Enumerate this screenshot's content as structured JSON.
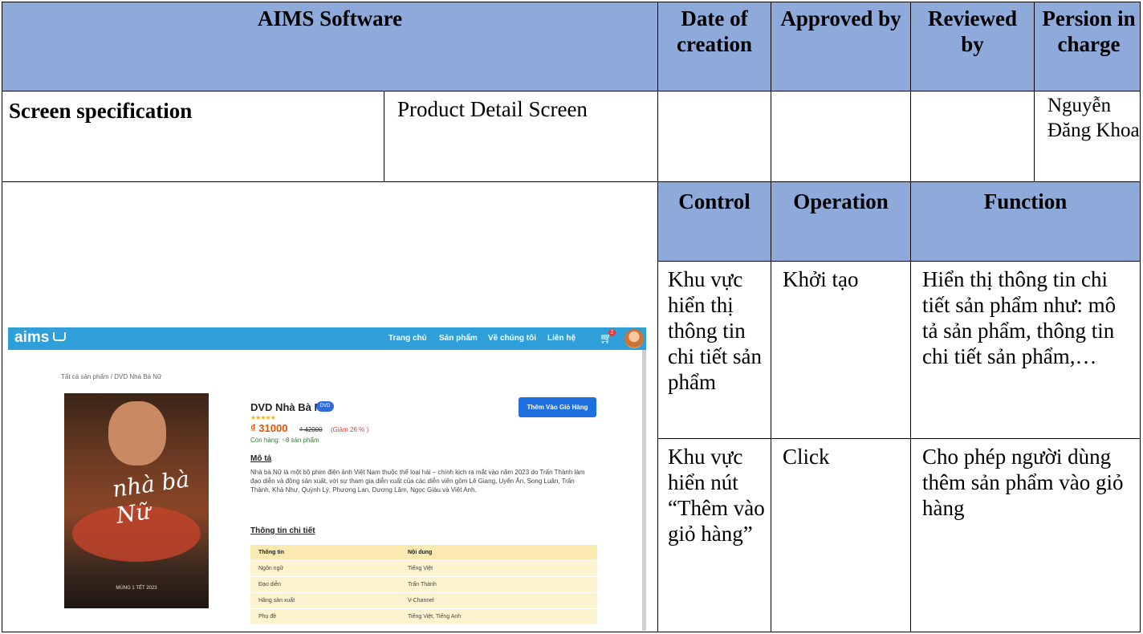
{
  "header": {
    "app": "AIMS Software",
    "date_of_creation": "Date of creation",
    "approved_by": "Approved by",
    "reviewed_by": "Reviewed by",
    "person_in_charge": "Persion in charge"
  },
  "spec": {
    "label": "Screen specification",
    "screen_name": "Product Detail Screen",
    "person": "Nguyễn Đăng Khoa"
  },
  "columns": {
    "control": "Control",
    "operation": "Operation",
    "function": "Function"
  },
  "rows": [
    {
      "control": "Khu vực hiển thị thông tin chi tiết sản phẩm",
      "operation": "Khởi tạo",
      "function": "Hiển thị thông tin chi tiết sản phẩm như: mô tả sản phẩm, thông tin chi tiết sản phẩm,…"
    },
    {
      "control": "Khu vực hiển nút “Thêm vào giỏ hàng”",
      "operation": "Click",
      "function": "Cho phép người dùng thêm sản phẩm vào giỏ hàng"
    }
  ],
  "screenshot": {
    "logo": "aims",
    "nav": [
      "Trang chủ",
      "Sản phẩm",
      "Về chúng tôi",
      "Liên hệ"
    ],
    "cart_count": "2",
    "breadcrumb": "Tất cả sản phẩm / DVD Nhà Bà Nữ",
    "product_title": "DVD Nhà Bà Nữ",
    "product_badge": "DVD",
    "stars": "★★★★★",
    "price": "₫ 31000",
    "old_price": "₫ 42000",
    "discount": "(Giảm 26 % )",
    "stock": "Còn hàng: ~8 sản phẩm",
    "add_to_cart": "Thêm Vào Giỏ Hàng",
    "desc_title": "Mô tả",
    "description": "Nhà bà Nữ là một bộ phim điện ảnh Việt Nam thuộc thể loại hài – chính kịch ra mắt vào năm 2023 do Trấn Thành làm đạo diễn và đồng sản xuất, với sự tham gia diễn xuất của các diễn viên gồm Lê Giang, Uyển Ân, Song Luân, Trấn Thành, Khả Như, Quỳnh Lý, Phương Lan, Dương Lâm, Ngọc Giàu và Việt Anh.",
    "details_title": "Thông tin chi tiết",
    "table_headers": [
      "Thông tin",
      "Nội dung"
    ],
    "table_rows": [
      [
        "Ngôn ngữ",
        "Tiếng Việt"
      ],
      [
        "Đạo diễn",
        "Trấn Thành"
      ],
      [
        "Hãng sản xuất",
        "V-Channel"
      ],
      [
        "Phụ đề",
        "Tiếng Việt, Tiếng Anh"
      ]
    ],
    "poster_title": "nhà bà Nữ",
    "poster_date": "MÙNG 1 TẾT 2023"
  }
}
